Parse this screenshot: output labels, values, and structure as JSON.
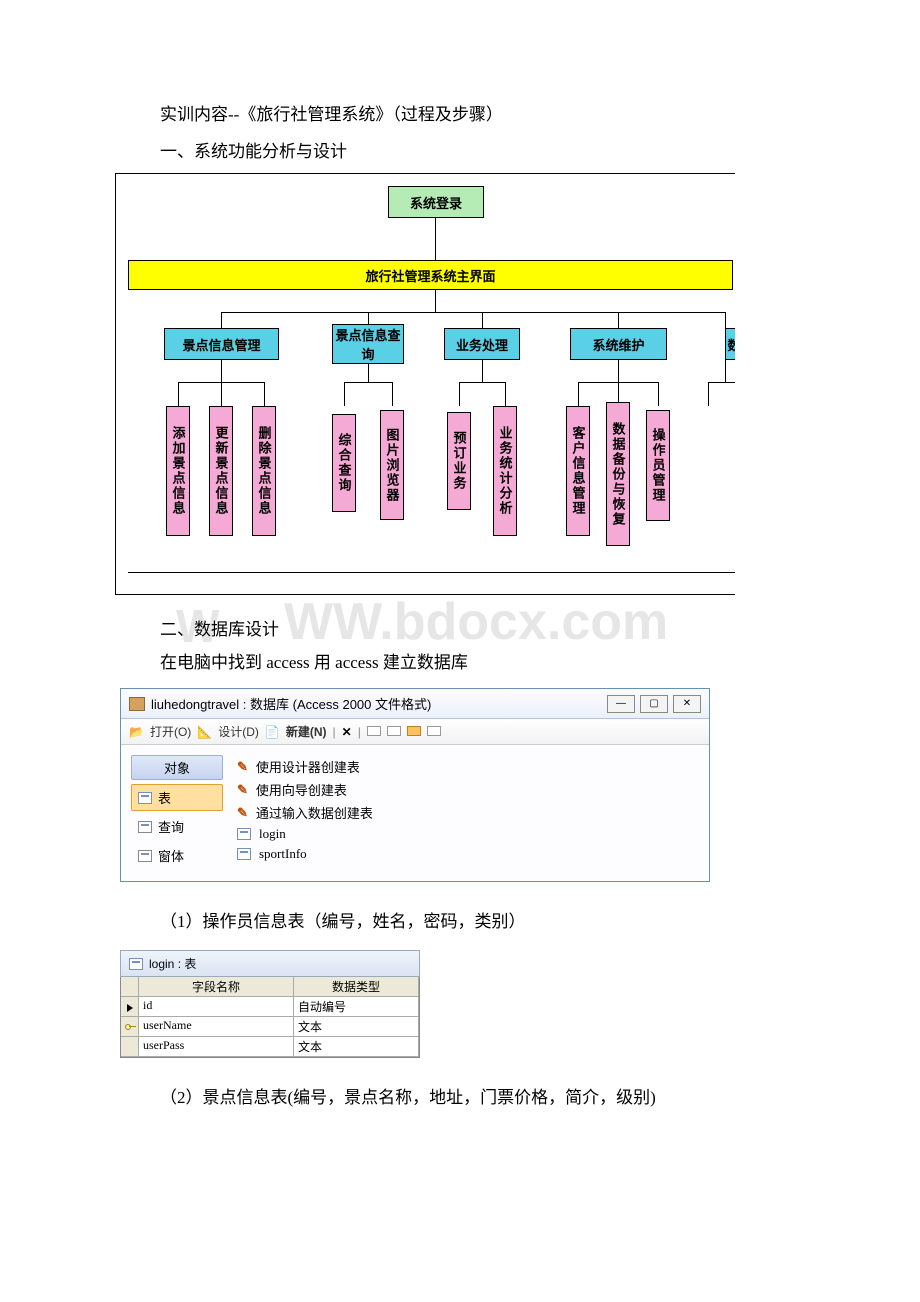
{
  "heading1": "实训内容--《旅行社管理系统》（过程及步骤）",
  "heading2": "一、系统功能分析与设计",
  "diagram": {
    "top": "系统登录",
    "main_bar": "旅行社管理系统主界面",
    "level2": [
      "景点信息管理",
      "景点信息查询",
      "业务处理",
      "系统维护"
    ],
    "level2_extra": "数",
    "leaves": [
      "添加景点信息",
      "更新景点信息",
      "删除景点信息",
      "综合查询",
      "图片浏览器",
      "预订业务",
      "业务统计分析",
      "客户信息管理",
      "数据备份与恢复",
      "操作员管理"
    ]
  },
  "watermark_left": "W",
  "watermark": "WW.bdocx.com",
  "section2_title": "二、数据库设计",
  "section2_body": "在电脑中找到 access 用 access 建立数据库",
  "access": {
    "title": "liuhedongtravel : 数据库 (Access 2000 文件格式)",
    "toolbar": {
      "open": "打开(O)",
      "design": "设计(D)",
      "new": "新建(N)"
    },
    "sidebar": {
      "header": "对象",
      "items": [
        "表",
        "查询",
        "窗体"
      ]
    },
    "main_items": [
      "使用设计器创建表",
      "使用向导创建表",
      "通过输入数据创建表",
      "login",
      "sportInfo"
    ]
  },
  "table1_caption": "（1）操作员信息表（编号，姓名，密码，类别）",
  "login_table": {
    "title": "login : 表",
    "header_field": "字段名称",
    "header_type": "数据类型",
    "rows": [
      {
        "field": "id",
        "type": "自动编号",
        "sel": "arrow"
      },
      {
        "field": "userName",
        "type": "文本",
        "sel": "key"
      },
      {
        "field": "userPass",
        "type": "文本",
        "sel": ""
      }
    ]
  },
  "table2_caption": "（2）景点信息表(编号，景点名称，地址，门票价格，简介，级别)"
}
